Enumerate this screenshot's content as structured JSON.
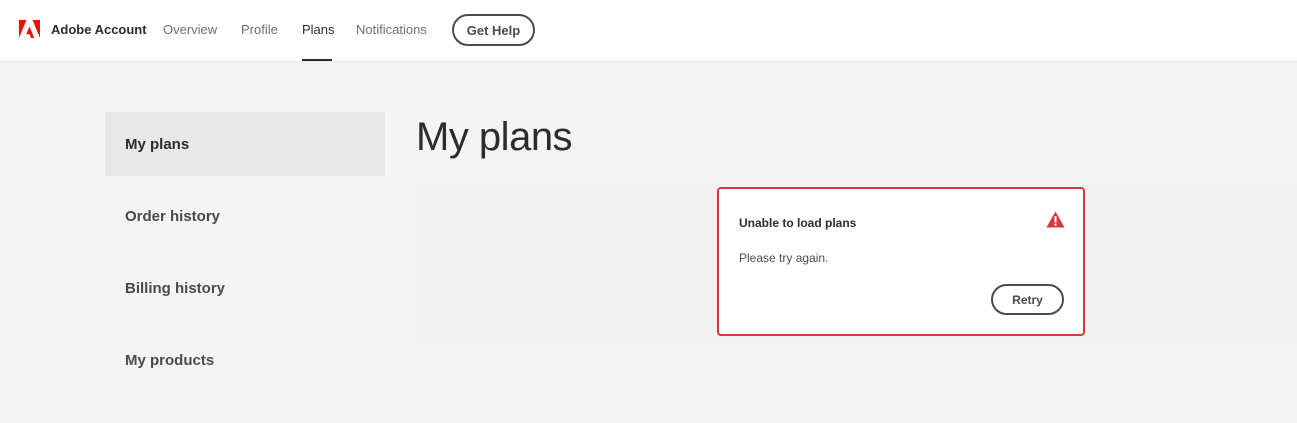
{
  "header": {
    "brand": "Adobe Account",
    "logo_icon": "adobe-logo-icon",
    "brand_color": "#eb1000",
    "nav": [
      {
        "label": "Overview",
        "active": false
      },
      {
        "label": "Profile",
        "active": false
      },
      {
        "label": "Plans",
        "active": true
      },
      {
        "label": "Notifications",
        "active": false
      }
    ],
    "help_label": "Get Help"
  },
  "sidebar": {
    "items": [
      {
        "label": "My plans",
        "selected": true
      },
      {
        "label": "Order history",
        "selected": false
      },
      {
        "label": "Billing history",
        "selected": false
      },
      {
        "label": "My products",
        "selected": false
      }
    ]
  },
  "main": {
    "title": "My plans",
    "error": {
      "title": "Unable to load plans",
      "message": "Please try again.",
      "icon": "alert-triangle-icon",
      "accent_color": "#d7373f",
      "retry_label": "Retry"
    }
  }
}
